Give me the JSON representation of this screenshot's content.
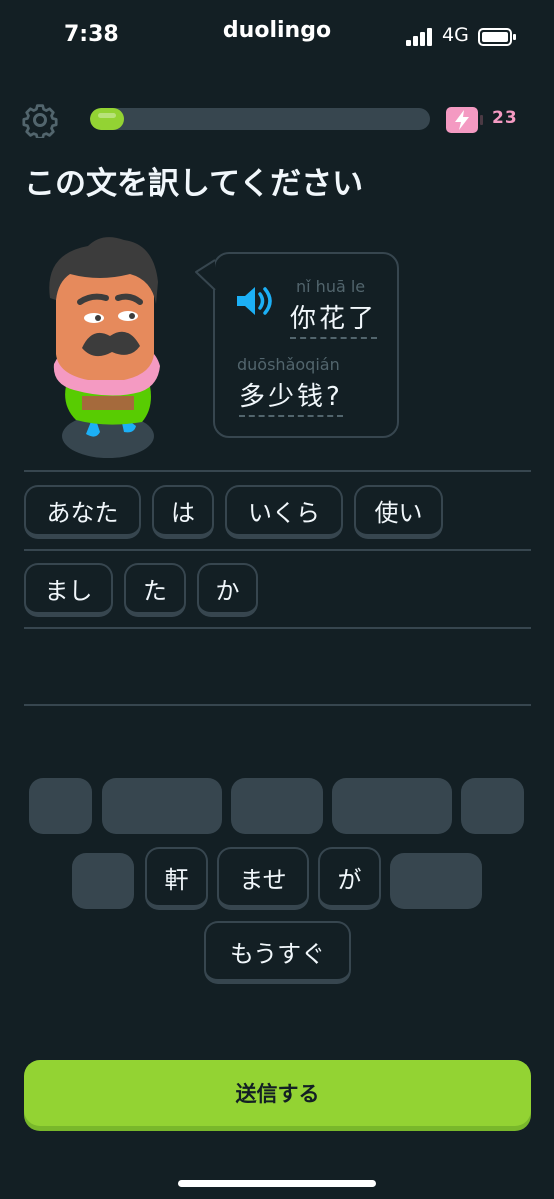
{
  "status_bar": {
    "time": "7:38",
    "network": "4G"
  },
  "app": {
    "title": "duolingo"
  },
  "header": {
    "progress_percent": 10,
    "energy_count": "23"
  },
  "prompt": {
    "instruction": "この文を訳してください"
  },
  "bubble": {
    "line1": {
      "pinyin": "nǐ huā le",
      "hanzi": "你花了"
    },
    "line2": {
      "pinyin": "duōshǎoqián",
      "hanzi": "多少钱?"
    }
  },
  "answer_tiles": [
    "あなた",
    "は",
    "いくら",
    "使い",
    "まし",
    "た",
    "か"
  ],
  "word_bank": [
    "軒",
    "ませ",
    "が",
    "もうすぐ"
  ],
  "submit_label": "送信する",
  "colors": {
    "background": "#131f24",
    "accent_green": "#93d333",
    "energy_pink": "#f49ac2",
    "speaker_blue": "#1cb0f6"
  }
}
